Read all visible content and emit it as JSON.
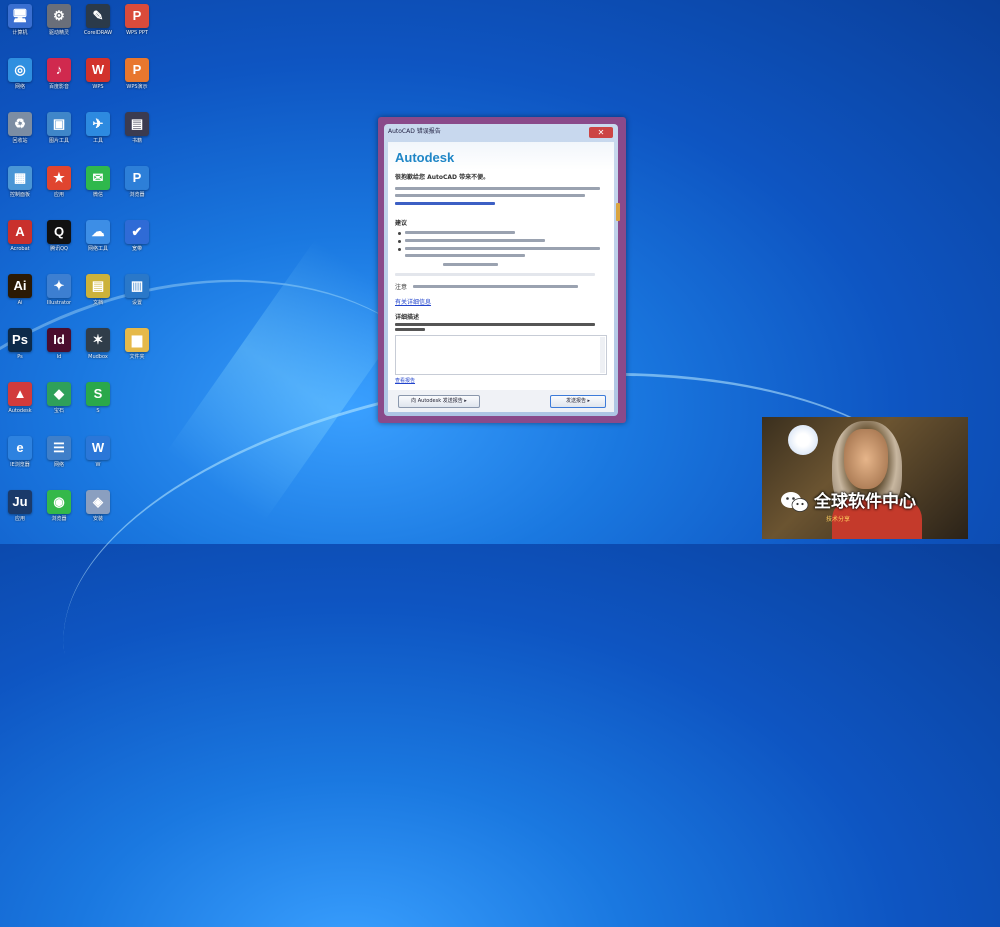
{
  "desktop": {
    "icons": [
      {
        "label": "计算机",
        "symbol": "🖥",
        "color": "#3a6fd1"
      },
      {
        "label": "驱动精灵",
        "symbol": "⚙",
        "color": "#6a6f7a"
      },
      {
        "label": "CorelDRAW",
        "symbol": "✎",
        "color": "#2b3a4a"
      },
      {
        "label": "WPS PPT",
        "symbol": "P",
        "color": "#d94b3b"
      },
      {
        "label": "网络",
        "symbol": "◎",
        "color": "#2f8fe0"
      },
      {
        "label": "百度影音",
        "symbol": "♪",
        "color": "#d0294e"
      },
      {
        "label": "WPS",
        "symbol": "W",
        "color": "#d2322c"
      },
      {
        "label": "WPS演示",
        "symbol": "P",
        "color": "#e8772e"
      },
      {
        "label": "回收站",
        "symbol": "♻",
        "color": "#7c8da3"
      },
      {
        "label": "图片工具",
        "symbol": "▣",
        "color": "#3f86c9"
      },
      {
        "label": "工具",
        "symbol": "✈",
        "color": "#2d8ae0"
      },
      {
        "label": "书籍",
        "symbol": "▤",
        "color": "#3b3b50"
      },
      {
        "label": "控制面板",
        "symbol": "▦",
        "color": "#4a96d6"
      },
      {
        "label": "应用",
        "symbol": "★",
        "color": "#e0452f"
      },
      {
        "label": "微信",
        "symbol": "✉",
        "color": "#2fb84c"
      },
      {
        "label": "浏览器",
        "symbol": "P",
        "color": "#2d7fd8"
      },
      {
        "label": "Acrobat",
        "symbol": "A",
        "color": "#c9302c"
      },
      {
        "label": "腾讯QQ",
        "symbol": "Q",
        "color": "#111111"
      },
      {
        "label": "网络工具",
        "symbol": "☁",
        "color": "#3d8ee6"
      },
      {
        "label": "宽带",
        "symbol": "✔",
        "color": "#2f6bd6"
      },
      {
        "label": "Ai",
        "symbol": "Ai",
        "color": "#2b1a05"
      },
      {
        "label": "Illustrator",
        "symbol": "✦",
        "color": "#3d7fd1"
      },
      {
        "label": "文档",
        "symbol": "▤",
        "color": "#ccb23a"
      },
      {
        "label": "设置",
        "symbol": "▥",
        "color": "#2a78c9"
      },
      {
        "label": "Ps",
        "symbol": "Ps",
        "color": "#0c2a4a"
      },
      {
        "label": "Id",
        "symbol": "Id",
        "color": "#4a0d2e"
      },
      {
        "label": "Mudbox",
        "symbol": "✶",
        "color": "#303d4a"
      },
      {
        "label": "文件夹",
        "symbol": "▆",
        "color": "#e5b94a"
      },
      {
        "label": "Autodesk",
        "symbol": "▲",
        "color": "#d23b3b"
      },
      {
        "label": "宝石",
        "symbol": "◆",
        "color": "#2fa05a"
      },
      {
        "label": "S",
        "symbol": "S",
        "color": "#2aa84a"
      },
      {
        "label": "",
        "symbol": "",
        "color": "rgba(0,0,0,0)"
      },
      {
        "label": "IE浏览器",
        "symbol": "e",
        "color": "#2d82e0"
      },
      {
        "label": "网络",
        "symbol": "☰",
        "color": "#3f7fc9"
      },
      {
        "label": "W",
        "symbol": "W",
        "color": "#2b77d8"
      },
      {
        "label": "",
        "symbol": "",
        "color": "rgba(0,0,0,0)"
      },
      {
        "label": "应用",
        "symbol": "Ju",
        "color": "#1a3a6a"
      },
      {
        "label": "浏览器",
        "symbol": "◉",
        "color": "#34b84a"
      },
      {
        "label": "安装",
        "symbol": "◈",
        "color": "#8a9fc0"
      },
      {
        "label": "",
        "symbol": "",
        "color": "rgba(0,0,0,0)"
      }
    ]
  },
  "dialog": {
    "title": "AutoCAD 错误报告",
    "close_symbol": "✕",
    "brand": "Autodesk",
    "line1": "很抱歉给您 AutoCAD 带来不便。",
    "section_label": "建议",
    "notice_label": "注意",
    "link_more": "有关详细信息",
    "details_label": "详细描述",
    "footer_link": "查看报告",
    "btn_left": "向 Autodesk 发送报告 ▸",
    "btn_right": "发送报告 ▸"
  },
  "overlay": {
    "watermark": "全球软件中心",
    "sub": "技术分享"
  }
}
